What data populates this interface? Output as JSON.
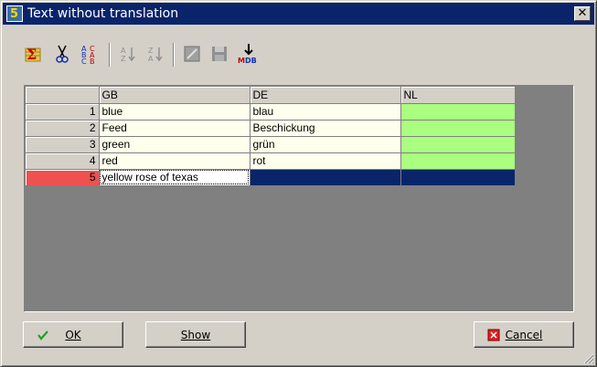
{
  "window": {
    "title": "Text without translation"
  },
  "toolbar": {
    "buttons": [
      {
        "name": "sum-icon",
        "glyph": "Σ"
      },
      {
        "name": "scissors-icon",
        "glyph": "✂"
      },
      {
        "name": "abc-icon",
        "glyph": "ABC"
      },
      {
        "name": "sort-az-icon",
        "glyph": "A↓"
      },
      {
        "name": "sort-za-icon",
        "glyph": "Z↓"
      },
      {
        "name": "edit-icon",
        "glyph": "✎"
      },
      {
        "name": "save-icon",
        "glyph": "💾"
      },
      {
        "name": "export-mdb-icon",
        "label": "MDB"
      }
    ]
  },
  "grid": {
    "columns": [
      "",
      "GB",
      "DE",
      "NL"
    ],
    "rows": [
      {
        "num": "1",
        "gb": "blue",
        "de": "blau",
        "nl": ""
      },
      {
        "num": "2",
        "gb": "Feed",
        "de": "Beschickung",
        "nl": ""
      },
      {
        "num": "3",
        "gb": "green",
        "de": "grün",
        "nl": ""
      },
      {
        "num": "4",
        "gb": "red",
        "de": "rot",
        "nl": ""
      },
      {
        "num": "5",
        "gb": "yellow rose of texas",
        "de": "",
        "nl": ""
      }
    ]
  },
  "buttons": {
    "ok": "OK",
    "show": "Show",
    "cancel": "Cancel"
  },
  "colors": {
    "titlebar": "#0a246a",
    "nl_missing": "#aaff80",
    "active_row": "#f05050",
    "cell_bg": "#ffffee"
  }
}
